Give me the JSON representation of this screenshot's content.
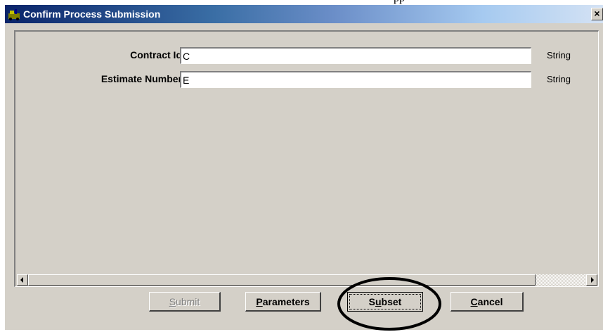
{
  "document": {
    "caption_fragment": "pp"
  },
  "window": {
    "title": "Confirm Process Submission",
    "title_icon": "app-icon",
    "close_label": "×"
  },
  "parameters": [
    {
      "label": "Contract Id",
      "value": "C",
      "type": "String"
    },
    {
      "label": "Estimate Number",
      "value": "E",
      "type": "String"
    }
  ],
  "buttons": {
    "submit": {
      "mnemonic": "S",
      "rest": "ubmit",
      "enabled": false
    },
    "parameters": {
      "mnemonic": "P",
      "rest": "arameters",
      "enabled": true
    },
    "subset": {
      "pre": "S",
      "mnemonic": "u",
      "rest": "bset",
      "enabled": true,
      "focused": true
    },
    "cancel": {
      "mnemonic": "C",
      "rest": "ancel",
      "enabled": true
    }
  },
  "annotation": {
    "shape": "ellipse",
    "target": "subset",
    "color": "#000000"
  },
  "colors": {
    "face": "#d4d0c8",
    "title_start": "#0a246a",
    "title_end": "#d4e2f4"
  }
}
